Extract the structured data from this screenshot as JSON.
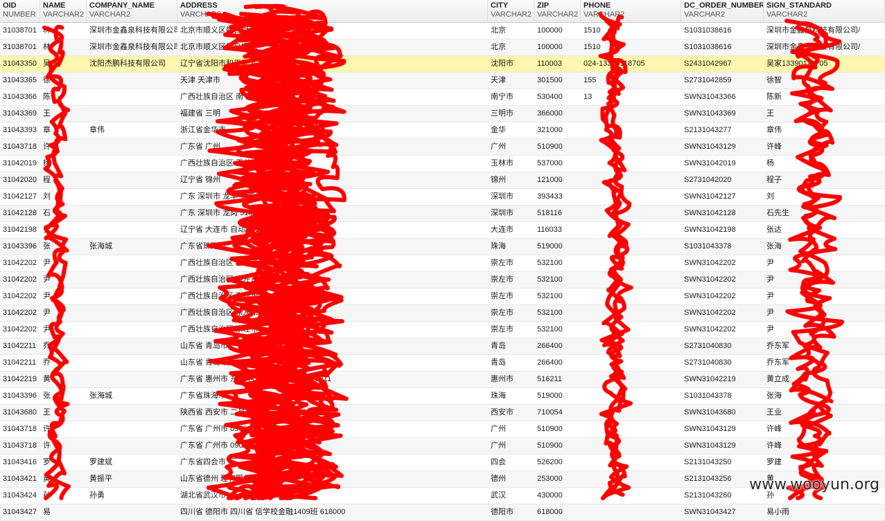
{
  "columns": [
    {
      "name": "OID",
      "type": "NUMBER"
    },
    {
      "name": "NAME",
      "type": "VARCHAR2"
    },
    {
      "name": "COMPANY_NAME",
      "type": "VARCHAR2"
    },
    {
      "name": "ADDRESS",
      "type": "VARCHAR2"
    },
    {
      "name": "CITY",
      "type": "VARCHAR2"
    },
    {
      "name": "ZIP",
      "type": "VARCHAR2"
    },
    {
      "name": "PHONE",
      "type": "VARCHAR2"
    },
    {
      "name": "DC_ORDER_NUMBER",
      "type": "VARCHAR2"
    },
    {
      "name": "SIGN_STANDARD",
      "type": "VARCHAR2"
    }
  ],
  "selected_row": 2,
  "rows": [
    [
      "31038701",
      "林",
      "深圳市金鑫泉科技有限公司",
      "北京市顺义区航自提",
      "北京",
      "100000",
      "1510",
      "S1031038616",
      "深圳市金鑫泉科技有限公司/"
    ],
    [
      "31038701",
      "林",
      "深圳市金鑫泉科技有限公司",
      "北京市顺义区航自提",
      "北京",
      "100000",
      "1510",
      "S1031038616",
      "深圳市金鑫泉科技有限公司/"
    ],
    [
      "31043350",
      "吴",
      "沈阳杰鹏科技有限公司",
      "辽宁省沈阳市和平区 A",
      "沈阳市",
      "110003",
      "024-13390118705",
      "S2431042967",
      "吴家13390118705"
    ],
    [
      "31043365",
      "徐",
      "",
      "天津 天津市",
      "天津",
      "301500",
      "155",
      "S2731042859",
      "徐智"
    ],
    [
      "31043366",
      "陈",
      "",
      "广西壮族自治区 南 三队 530400",
      "南宁市",
      "530400",
      "13",
      "SWN31043366",
      "陈新"
    ],
    [
      "31043369",
      "王",
      "",
      "福建省 三明",
      "三明市",
      "366000",
      "",
      "SWN31043369",
      "王"
    ],
    [
      "31043393",
      "章",
      "章伟",
      "浙江省金华市",
      "金华",
      "321000",
      "",
      "S2131043277",
      "章伟"
    ],
    [
      "31043718",
      "许",
      "",
      "广东省 广州",
      "广州",
      "510900",
      "",
      "SWN31043129",
      "许峰"
    ],
    [
      "31042019",
      "杨",
      "",
      "广西壮族自治区 玉林市",
      "玉林市",
      "537000",
      "",
      "SWN31042019",
      "杨"
    ],
    [
      "31042020",
      "程",
      "",
      "辽宁省 锦州",
      "锦州",
      "121000",
      "",
      "S2731042020",
      "程子"
    ],
    [
      "31042127",
      "刘",
      "",
      "广东 深圳市 龙华 养鸡场收 393433",
      "深圳市",
      "393433",
      "",
      "SWN31042127",
      "刘"
    ],
    [
      "31042128",
      "石",
      "",
      "广东 深圳市 龙岗 518116",
      "深圳市",
      "518116",
      "",
      "SWN31042128",
      "石先生"
    ],
    [
      "31042198",
      "张",
      "",
      "辽宁省 大连市 自动化 116033",
      "大连市",
      "116033",
      "",
      "SWN31042198",
      "张达"
    ],
    [
      "31043396",
      "张",
      "张海城",
      "广东省珠海市",
      "珠海",
      "519000",
      "",
      "S1031043378",
      "张海"
    ],
    [
      "31042202",
      "尹",
      "",
      "广西壮族自治区 崇左市",
      "崇左市",
      "532100",
      "",
      "SWN31042202",
      "尹"
    ],
    [
      "31042202",
      "尹",
      "",
      "广西壮族自治区 崇左市",
      "崇左市",
      "532100",
      "",
      "SWN31042202",
      "尹"
    ],
    [
      "31042202",
      "尹",
      "",
      "广西壮族自治区 崇左市",
      "崇左市",
      "532100",
      "",
      "SWN31042202",
      "尹"
    ],
    [
      "31042202",
      "尹",
      "",
      "广西壮族自治区 崇左市",
      "崇左市",
      "532100",
      "",
      "SWN31042202",
      "尹"
    ],
    [
      "31042202",
      "尹",
      "",
      "广西壮族自治区 崇左市",
      "崇左市",
      "532100",
      "",
      "SWN31042202",
      "尹"
    ],
    [
      "31042211",
      "乔",
      "",
      "山东省 青岛市",
      "青岛",
      "266400",
      "",
      "S2731040830",
      "乔东军"
    ],
    [
      "31042211",
      "乔",
      "",
      "山东省 青岛市",
      "青岛",
      "266400",
      "",
      "S2731040830",
      "乔东军"
    ],
    [
      "31042219",
      "黄",
      "",
      "广东省 惠州市 东路 杏林苑2栋B1601 516211",
      "惠州市",
      "516211",
      "",
      "SWN31042219",
      "黄立成"
    ],
    [
      "31043396",
      "张",
      "张海城",
      "广东省珠海市",
      "珠海",
      "519000",
      "",
      "S1031043378",
      "张海"
    ],
    [
      "31043680",
      "王",
      "",
      "陕西省 西安市 二号楼三单元202室 710054",
      "西安市",
      "710054",
      "",
      "SWN31043680",
      "王业"
    ],
    [
      "31043718",
      "许",
      "",
      "广东省 广州市 0900",
      "广州",
      "510900",
      "",
      "SWN31043129",
      "许峰"
    ],
    [
      "31043718",
      "许",
      "",
      "广东省 广州市 0900",
      "广州",
      "510900",
      "",
      "SWN31043129",
      "许峰"
    ],
    [
      "31043416",
      "罗",
      "罗建斌",
      "广东省四会市 厂",
      "四会",
      "526200",
      "",
      "S2131043250",
      "罗建"
    ],
    [
      "31043421",
      "黄",
      "黄振平",
      "山东省德州 理有限公司",
      "德州",
      "253000",
      "",
      "S2131043256",
      "黄"
    ],
    [
      "31043424",
      "孙",
      "孙勇",
      "湖北省武汉市",
      "武汉",
      "430000",
      "",
      "S2131043260",
      "孙"
    ],
    [
      "31043427",
      "易",
      "",
      "四川省 德阳市 四川省 信学校金融1409班 618000",
      "德阳市",
      "618000",
      "",
      "SWN31043427",
      "易小雨"
    ]
  ],
  "watermark": "www.wooyun.org",
  "scribble_color": "#ff0000"
}
